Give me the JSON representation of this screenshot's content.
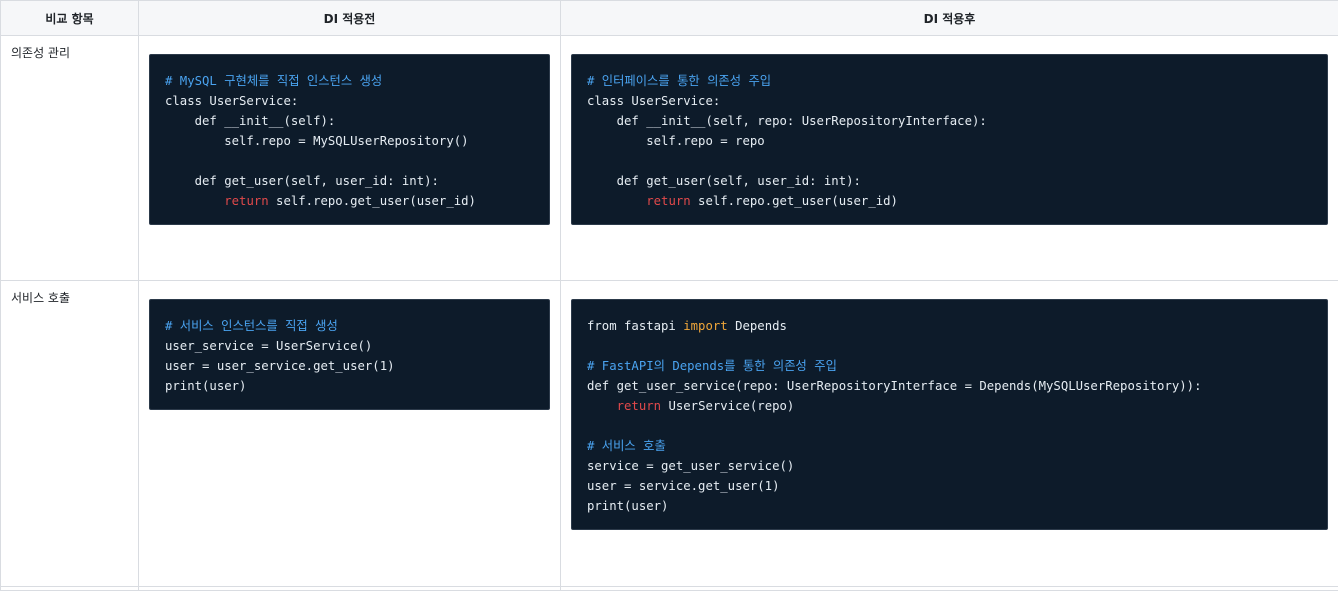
{
  "table": {
    "headers": [
      "비교 항목",
      "DI 적용전",
      "DI 적용후"
    ],
    "rows": [
      {
        "label": "의존성 관리",
        "before": [
          [
            {
              "t": "# MySQL 구현체를 직접 인스턴스 생성",
              "c": "comment"
            }
          ],
          [
            {
              "t": "class UserService:",
              "c": "plain"
            }
          ],
          [
            {
              "t": "    def __init__(self):",
              "c": "plain"
            }
          ],
          [
            {
              "t": "        self.repo = MySQLUserRepository()",
              "c": "plain"
            }
          ],
          [],
          [
            {
              "t": "    def get_user(self, user_id: int):",
              "c": "plain"
            }
          ],
          [
            {
              "t": "        ",
              "c": "plain"
            },
            {
              "t": "return",
              "c": "kw"
            },
            {
              "t": " self.repo.get_user(user_id)",
              "c": "plain"
            }
          ]
        ],
        "after": [
          [
            {
              "t": "# 인터페이스를 통한 의존성 주입",
              "c": "comment"
            }
          ],
          [
            {
              "t": "class UserService:",
              "c": "plain"
            }
          ],
          [
            {
              "t": "    def __init__(self, repo: UserRepositoryInterface):",
              "c": "plain"
            }
          ],
          [
            {
              "t": "        self.repo = repo",
              "c": "plain"
            }
          ],
          [],
          [
            {
              "t": "    def get_user(self, user_id: int):",
              "c": "plain"
            }
          ],
          [
            {
              "t": "        ",
              "c": "plain"
            },
            {
              "t": "return",
              "c": "kw"
            },
            {
              "t": " self.repo.get_user(user_id)",
              "c": "plain"
            }
          ]
        ]
      },
      {
        "label": "서비스 호출",
        "before": [
          [
            {
              "t": "# 서비스 인스턴스를 직접 생성",
              "c": "comment"
            }
          ],
          [
            {
              "t": "user_service = UserService()",
              "c": "plain"
            }
          ],
          [
            {
              "t": "user = user_service.get_user(1)",
              "c": "plain"
            }
          ],
          [
            {
              "t": "print(user)",
              "c": "plain"
            }
          ]
        ],
        "after": [
          [
            {
              "t": "from fastapi ",
              "c": "plain"
            },
            {
              "t": "import",
              "c": "import"
            },
            {
              "t": " Depends",
              "c": "plain"
            }
          ],
          [],
          [
            {
              "t": "# FastAPI의 Depends를 통한 의존성 주입",
              "c": "comment"
            }
          ],
          [
            {
              "t": "def get_user_service(repo: UserRepositoryInterface = Depends(MySQLUserRepository)):",
              "c": "plain"
            }
          ],
          [
            {
              "t": "    ",
              "c": "plain"
            },
            {
              "t": "return",
              "c": "kw"
            },
            {
              "t": " UserService(repo)",
              "c": "plain"
            }
          ],
          [],
          [
            {
              "t": "# 서비스 호출",
              "c": "comment"
            }
          ],
          [
            {
              "t": "service = get_user_service()",
              "c": "plain"
            }
          ],
          [
            {
              "t": "user = service.get_user(1)",
              "c": "plain"
            }
          ],
          [
            {
              "t": "print(user)",
              "c": "plain"
            }
          ]
        ]
      }
    ]
  }
}
